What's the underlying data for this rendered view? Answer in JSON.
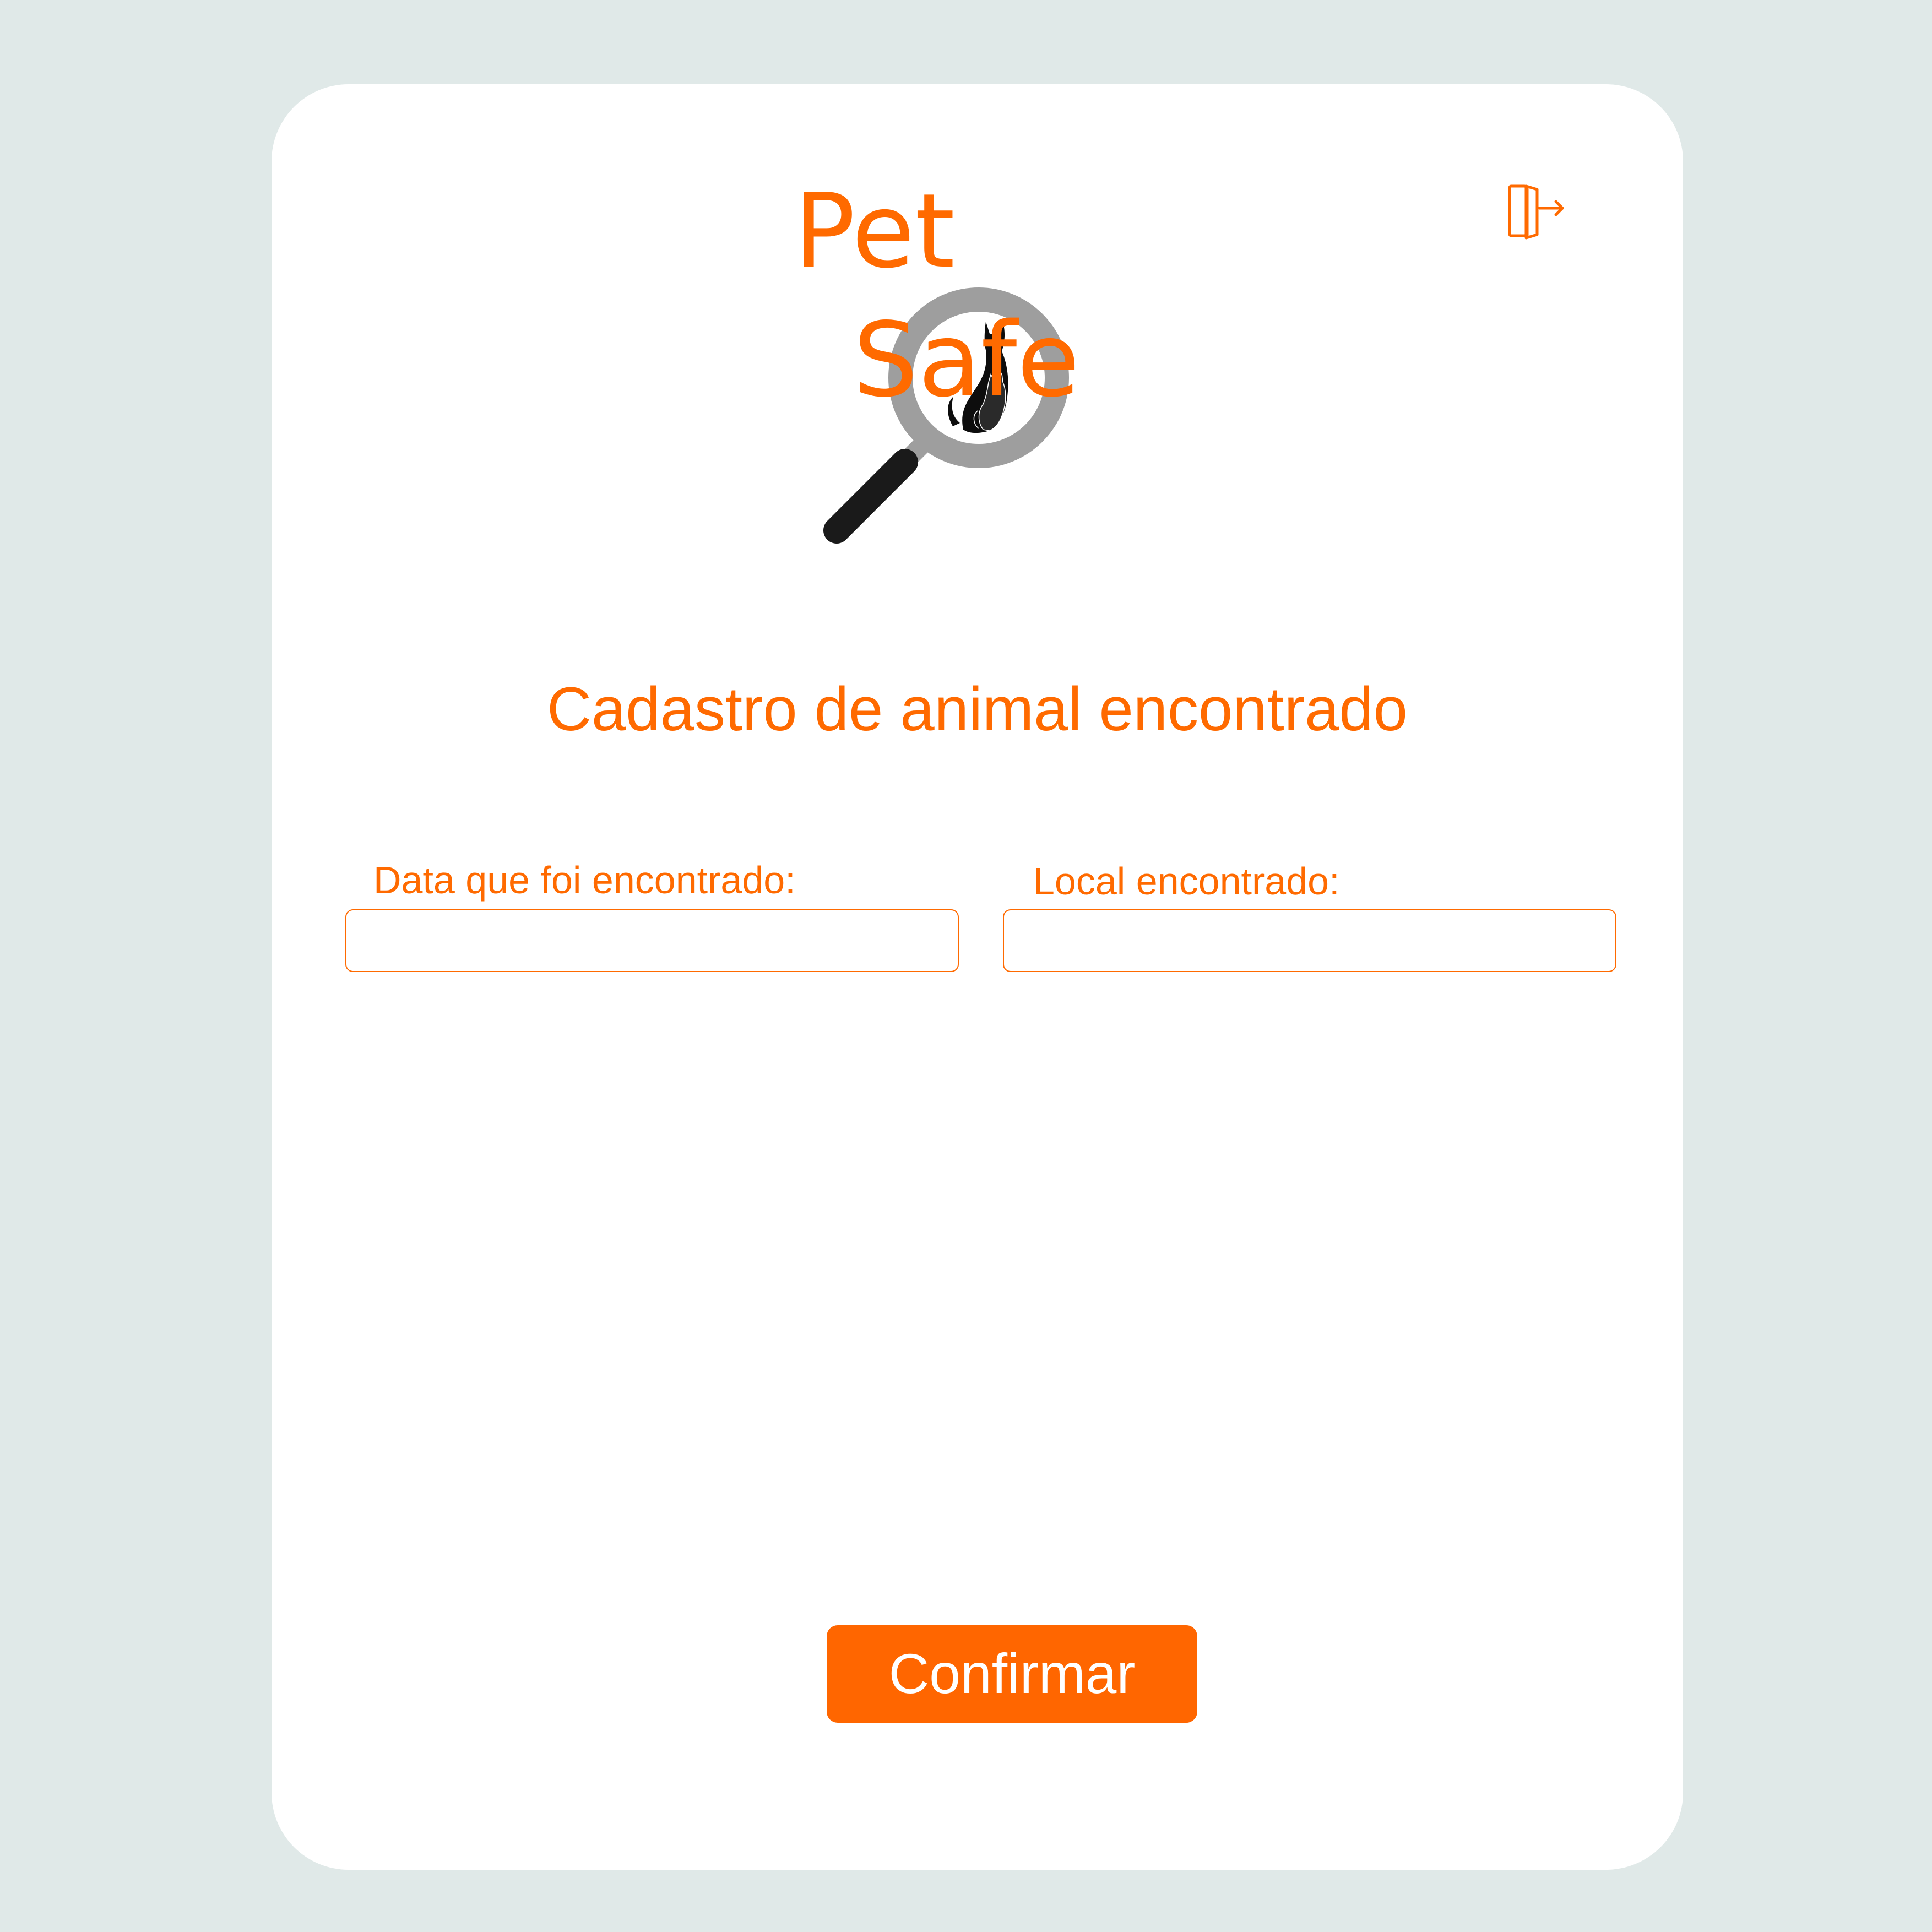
{
  "brand": {
    "word1": "Pet",
    "word2": "Safe",
    "logo_icon": "magnifier-with-dog-and-cat-icon"
  },
  "header": {
    "exit_icon": "logout-door-icon"
  },
  "page": {
    "title": "Cadastro de animal encontrado"
  },
  "form": {
    "date_label": "Data que foi encontrado:",
    "date_value": "",
    "location_label": "Local encontrado:",
    "location_value": ""
  },
  "actions": {
    "confirm_label": "Confirmar"
  },
  "colors": {
    "accent": "#ff6a00",
    "background": "#e0e9e8",
    "card": "#ffffff",
    "magnifier_ring": "#9e9e9e",
    "magnifier_handle": "#1a1a1a"
  }
}
